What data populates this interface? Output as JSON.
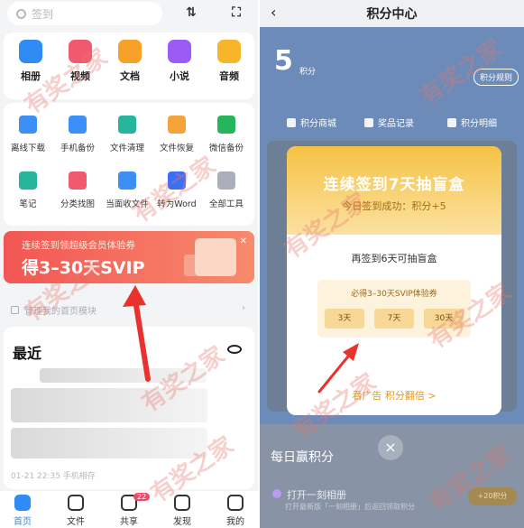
{
  "left": {
    "search": {
      "placeholder": "签到"
    },
    "apps": [
      {
        "label": "相册",
        "color": "#2f8cf4"
      },
      {
        "label": "视频",
        "color": "#f05a6e"
      },
      {
        "label": "文档",
        "color": "#f7a12b"
      },
      {
        "label": "小说",
        "color": "#9b5cf6"
      },
      {
        "label": "音频",
        "color": "#f7b52b"
      }
    ],
    "tools_row1": [
      {
        "label": "离线下载",
        "color": "#3c8ff5"
      },
      {
        "label": "手机备份",
        "color": "#3c8ff5"
      },
      {
        "label": "文件清理",
        "color": "#27b59d"
      },
      {
        "label": "文件恢复",
        "color": "#f3a43a"
      },
      {
        "label": "微信备份",
        "color": "#26b55b"
      }
    ],
    "tools_row2": [
      {
        "label": "笔记",
        "color": "#27b59d"
      },
      {
        "label": "分类找图",
        "color": "#f05a6e"
      },
      {
        "label": "当面收文件",
        "color": "#3c8ff5"
      },
      {
        "label": "转为Word",
        "color": "#3c6ff5"
      },
      {
        "label": "全部工具",
        "color": "#aab0bb"
      }
    ],
    "banner": {
      "line1": "连续签到领超级会员体验券",
      "line2": "得3–30天SVIP"
    },
    "manage": "管理我的首页模块",
    "recent": {
      "title": "最近",
      "time": "01-21 22:35  手机相存"
    },
    "tabs": [
      {
        "label": "首页",
        "active": true
      },
      {
        "label": "文件",
        "active": false
      },
      {
        "label": "共享",
        "active": false,
        "badge": "22"
      },
      {
        "label": "发现",
        "active": false
      },
      {
        "label": "我的",
        "active": false
      }
    ],
    "watermark": "有奖之家"
  },
  "right": {
    "header": {
      "back": "‹",
      "title": "积分中心"
    },
    "points": {
      "value": "5",
      "unit": "积分",
      "rules": "积分规则"
    },
    "menu": [
      "积分商城",
      "奖品记录",
      "积分明细"
    ],
    "dialog": {
      "title": "连续签到7天抽盲盒",
      "today": "今日签到成功：积分+5",
      "sub": "再签到6天可抽盲盒",
      "voucher_title": "必得3–30天SVIP体验券",
      "chips": [
        "3天",
        "7天",
        "30天"
      ],
      "link": "看广告 积分翻倍 >"
    },
    "daily": "每日赢积分",
    "task": {
      "title": "打开一刻相册",
      "desc": "打开最新版「一刻相册」后返回领取积分",
      "btn": "+20积分"
    },
    "close": "×"
  }
}
